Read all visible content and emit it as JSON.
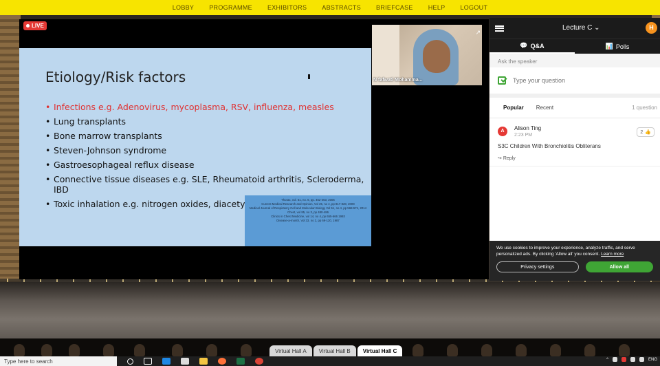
{
  "nav": [
    "LOBBY",
    "PROGRAMME",
    "EXHIBITORS",
    "ABSTRACTS",
    "BRIEFCASE",
    "HELP",
    "LOGOUT"
  ],
  "video": {
    "live_label": "LIVE",
    "speaker_name": "N fafwati Mohamma..."
  },
  "slide": {
    "title": "Etiology/Risk factors",
    "bullets": [
      "Infections e.g. Adenovirus, mycoplasma, RSV, influenza, measles",
      "Lung transplants",
      "Bone marrow transplants",
      "Steven-Johnson syndrome",
      "Gastroesophageal reflux disease",
      "Connective tissue diseases e.g. SLE, Rheumatoid arthritis, Scleroderma, IBD",
      "Toxic inhalation e.g. nitrogen oxides, diacetyl"
    ],
    "references": [
      "Thorax, vol. 61, no. 6, pp. 462-463, 2006",
      "Current Medical Research and Opinion, Vol 25, no 4, pp 817-828, 2009",
      "Medical Journal of Respiratory Cell and Molecular Biology Vol 51, no 4, pp 568-574, 2014",
      "Chest, vol 85, no 3, pp 480-486",
      "Clinics in Chest Medicine, vol 14, no 4, pp 655-666 1993",
      "Disease-a-month, Vol 33, no 2, pp 69-120, 1987"
    ]
  },
  "panel": {
    "lecture": "Lecture C",
    "avatar_initial": "H",
    "tab_qa": "Q&A",
    "tab_polls": "Polls",
    "ask_label": "Ask the speaker",
    "question_placeholder": "Type your question",
    "sort_popular": "Popular",
    "sort_recent": "Recent",
    "question_count": "1 question",
    "questions": [
      {
        "initial": "A",
        "author": "Alison Ting",
        "time": "2:23 PM",
        "votes": "2",
        "text": "S3C Children With Bronchiolitis Obliterans",
        "reply": "Reply"
      }
    ]
  },
  "cookie": {
    "text": "We use cookies to improve your experience, analyze traffic, and serve personalized ads. By clicking 'Allow all' you consent.",
    "link": "Learn more",
    "privacy_button": "Privacy settings",
    "allow_button": "Allow all"
  },
  "halls": [
    "Virtual Hall A",
    "Virtual Hall B",
    "Virtual Hall C"
  ],
  "taskbar": {
    "search_placeholder": "Type here to search",
    "lang": "ENG"
  },
  "colors": {
    "nav_bg": "#f7e400",
    "live_red": "#e53935",
    "accent_green": "#3fa535",
    "avatar_orange": "#f7931e",
    "slide_bg": "#bdd7ee",
    "refs_bg": "#5b9bd5"
  }
}
